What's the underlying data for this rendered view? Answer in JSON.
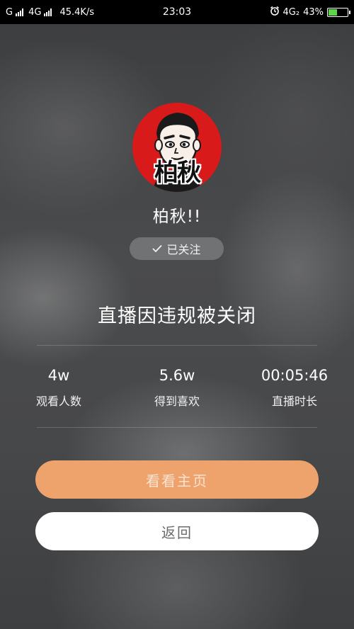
{
  "status_bar": {
    "carrier1": "G",
    "carrier2": "4G",
    "net_speed": "45.4K/s",
    "time": "23:03",
    "network_right": "4G₂",
    "battery_percent": "43%",
    "battery_level": 0.43,
    "battery_color": "#5fd34b"
  },
  "profile": {
    "avatar_text": "柏秋",
    "avatar_bg": "#d91a1a",
    "name": "柏秋!!",
    "follow_label": "已关注"
  },
  "main": {
    "title": "直播因违规被关闭"
  },
  "stats": [
    {
      "value": "4w",
      "label": "观看人数"
    },
    {
      "value": "5.6w",
      "label": "得到喜欢"
    },
    {
      "value": "00:05:46",
      "label": "直播时长"
    }
  ],
  "buttons": {
    "home_label": "看看主页",
    "home_color": "#eea26c",
    "back_label": "返回",
    "back_color": "#ffffff"
  }
}
